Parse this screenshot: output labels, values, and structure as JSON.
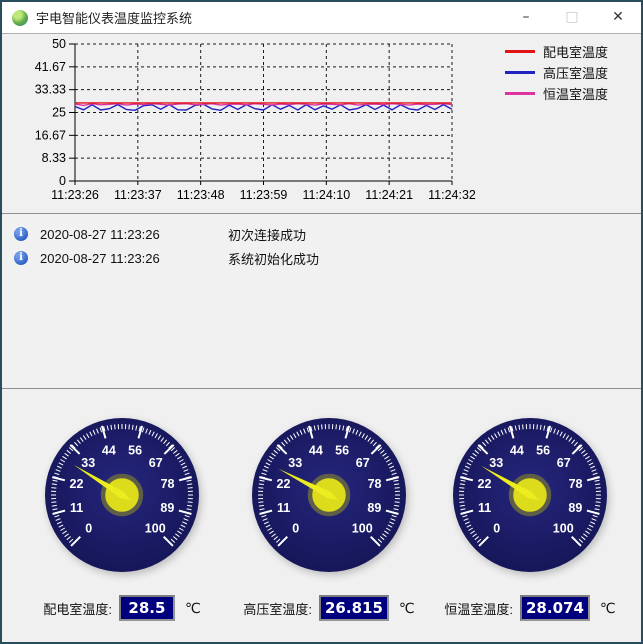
{
  "window": {
    "title": "宇电智能仪表温度监控系统",
    "controls": {
      "minimize": "–",
      "maximize": "□",
      "close": "✕"
    }
  },
  "chart_data": {
    "type": "line",
    "title": "",
    "xlabel": "",
    "ylabel": "",
    "ylim": [
      0,
      50
    ],
    "grid": "dashed",
    "legend_position": "right",
    "y_ticks": [
      "50",
      "41.67",
      "33.33",
      "25",
      "16.67",
      "8.33",
      "0"
    ],
    "x_ticks": [
      "11:23:26",
      "11:23:37",
      "11:23:48",
      "11:23:59",
      "11:24:10",
      "11:24:21",
      "11:24:32"
    ],
    "series": [
      {
        "name": "高压室温度",
        "color": "#2222c0",
        "values": [
          27.2,
          26.0,
          27.8,
          25.9,
          26.4,
          27.9,
          26.1,
          25.8,
          27.5,
          27.8,
          26.2,
          27.9,
          26.0,
          25.9,
          27.6,
          28.0,
          26.3,
          25.8,
          27.7,
          26.1,
          27.9,
          26.4,
          25.9,
          27.8,
          26.2,
          27.6,
          25.9,
          27.9,
          26.0,
          27.4,
          26.2,
          27.8,
          25.9,
          26.5,
          27.9,
          26.1,
          27.7,
          26.0,
          27.8,
          26.3,
          25.9,
          27.6,
          26.1,
          27.9,
          26.2
        ]
      },
      {
        "name": "恒温室温度",
        "color": "#dd33a0",
        "values": [
          28.1,
          27.6,
          28.2,
          27.8,
          28.0,
          28.2,
          27.7,
          28.1,
          27.9,
          28.2,
          28.0,
          27.7,
          28.1,
          28.2,
          27.8,
          28.0,
          28.2,
          27.7,
          28.0,
          28.1,
          27.8,
          28.2,
          28.0,
          27.7,
          28.1,
          27.9,
          28.2,
          28.0,
          27.7,
          28.1,
          28.0,
          27.8,
          28.2,
          27.7,
          28.0,
          28.1,
          27.9,
          28.2,
          28.0,
          27.7,
          28.1,
          27.9,
          28.0,
          28.2,
          27.9
        ]
      },
      {
        "name": "配电室温度",
        "color": "#e01414",
        "values": [
          28.5,
          28.5,
          28.5,
          28.5,
          28.5,
          28.5,
          28.5,
          28.5,
          28.5,
          28.5,
          28.5,
          28.5,
          28.5,
          28.5,
          28.5,
          28.5,
          28.5,
          28.5,
          28.5,
          28.5,
          28.5,
          28.5,
          28.5,
          28.5,
          28.5,
          28.5,
          28.5,
          28.5,
          28.5,
          28.5,
          28.5,
          28.5,
          28.5,
          28.5,
          28.5,
          28.5,
          28.5,
          28.5,
          28.5,
          28.5,
          28.5,
          28.5,
          28.5,
          28.5,
          28.5
        ]
      }
    ],
    "legend_order": [
      "配电室温度",
      "高压室温度",
      "恒温室温度"
    ]
  },
  "log": {
    "entries": [
      {
        "icon": "info",
        "time": "2020-08-27 11:23:26",
        "message": "初次连接成功"
      },
      {
        "icon": "info",
        "time": "2020-08-27 11:23:26",
        "message": "系统初始化成功"
      }
    ]
  },
  "gauges": {
    "min": 0,
    "max": 100,
    "sweep_deg": 270,
    "start_deg": 135,
    "scale_labels": [
      "0",
      "11",
      "22",
      "33",
      "44",
      "56",
      "67",
      "78",
      "89",
      "100"
    ],
    "colors": {
      "dial_center": "#26267e",
      "dial_edge": "#131352",
      "tick": "#ffffff",
      "needle": "#ecec1e",
      "hub": "#dcdc1c",
      "hub_ring": "#5f5f48",
      "value_bg": "#00007e"
    },
    "items": [
      {
        "label": "配电室温度:",
        "value": 28.5,
        "display": "28.5",
        "unit": "℃"
      },
      {
        "label": "高压室温度:",
        "value": 26.815,
        "display": "26.815",
        "unit": "℃"
      },
      {
        "label": "恒温室温度:",
        "value": 28.074,
        "display": "28.074",
        "unit": "℃"
      }
    ]
  }
}
